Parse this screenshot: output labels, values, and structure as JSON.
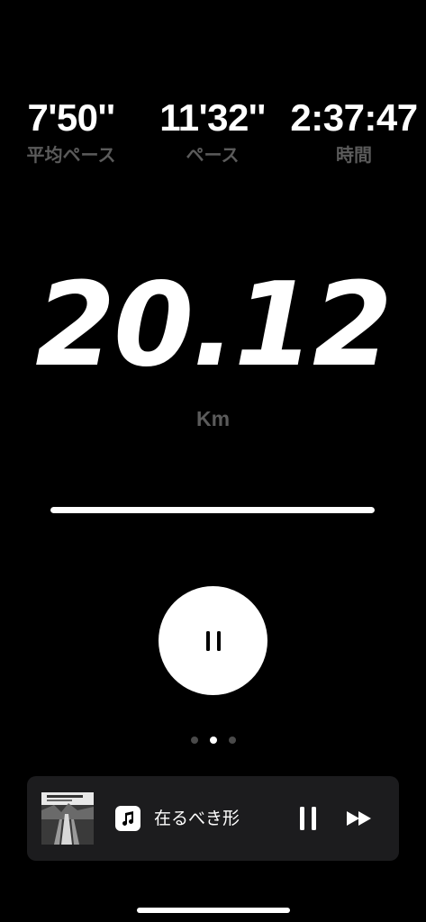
{
  "stats": {
    "avg_pace": {
      "value": "7'50''",
      "label": "平均ペース"
    },
    "pace": {
      "value": "11'32''",
      "label": "ペース"
    },
    "time": {
      "value": "2:37:47",
      "label": "時間"
    }
  },
  "distance": {
    "value": "20.12",
    "unit": "Km"
  },
  "progress": {
    "fraction": 1.0
  },
  "controls": {
    "pause_icon": "pause-icon"
  },
  "page_indicator": {
    "count": 3,
    "active_index": 1
  },
  "now_playing": {
    "title": "在るべき形",
    "app_icon": "music-note-icon",
    "pause_icon": "pause-icon",
    "forward_icon": "fast-forward-icon"
  },
  "colors": {
    "background": "#000000",
    "primary_text": "#ffffff",
    "secondary_text": "#5b5b5b",
    "card_background": "#1c1c1e"
  }
}
